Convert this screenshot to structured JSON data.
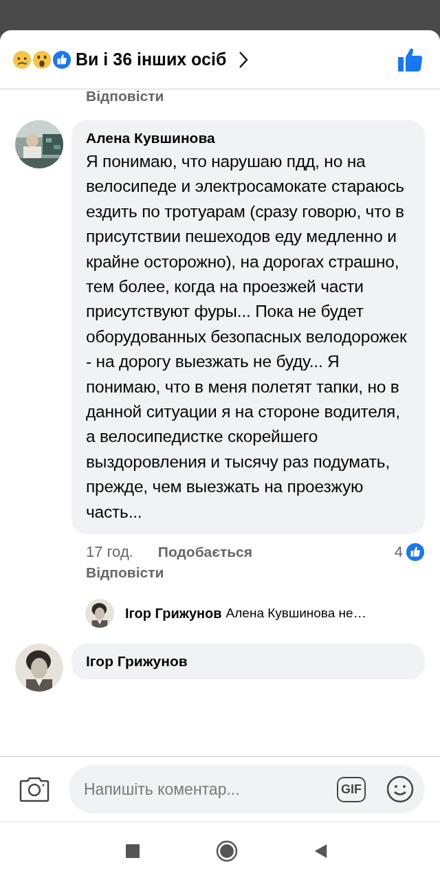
{
  "header": {
    "title": "Ви і 36 інших осіб",
    "liked": true
  },
  "thread": [
    {
      "kind": "action",
      "text": "Відповісти"
    },
    {
      "kind": "comment",
      "author": "Алена Кувшинова",
      "text": "Я понимаю, что нарушаю пдд, но на велосипеде и электросамокате стараюсь ездить по тротуарам (сразу говорю, что в присутствии пешеходов еду медленно и крайне осторожно), на дорогах страшно, тем более, когда на проезжей части присутствуют фуры... Пока не будет оборудованных безопасных велодорожек - на дорогу  выезжать не буду... Я понимаю, что в меня полетят тапки, но в данной ситуации я на стороне водителя, а велосипедистке скорейшего выздоровления и тысячу раз подумать, прежде, чем выезжать на проезжую часть...",
      "time": "17 год.",
      "like_action": "Подобається",
      "reply_action": "Відповісти",
      "like_count": "4"
    },
    {
      "kind": "reply_preview",
      "author": "Ігор Грижунов",
      "text": "Алена Кувшинова не…"
    },
    {
      "kind": "comment",
      "author": "Ігор Грижунов"
    }
  ],
  "composer": {
    "placeholder": "Напишіть коментар...",
    "gif": "GIF"
  }
}
